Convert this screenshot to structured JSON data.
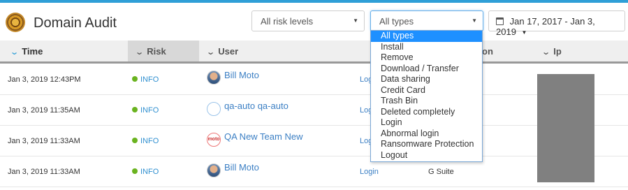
{
  "header": {
    "title": "Domain Audit",
    "risk_select": "All risk levels",
    "type_select": "All types",
    "date_range": "Jan 17, 2017 - Jan 3, 2019"
  },
  "table": {
    "columns": [
      "Time",
      "Risk",
      "User",
      "on",
      "Ip"
    ],
    "rows": [
      {
        "time": "Jan 3, 2019 12:43PM",
        "risk": "INFO",
        "user": "Bill Moto",
        "event": "Login",
        "source": ""
      },
      {
        "time": "Jan 3, 2019 11:35AM",
        "risk": "INFO",
        "user": "qa-auto qa-auto",
        "event": "Login",
        "source": ""
      },
      {
        "time": "Jan 3, 2019 11:33AM",
        "risk": "INFO",
        "user": "QA New Team New",
        "event": "Login",
        "source": ""
      },
      {
        "time": "Jan 3, 2019 11:33AM",
        "risk": "INFO",
        "user": "Bill Moto",
        "event": "Login",
        "source": "G Suite"
      }
    ]
  },
  "type_dropdown": {
    "options": [
      "All types",
      "Install",
      "Remove",
      "Download / Transfer",
      "Data sharing",
      "Credit Card",
      "Trash Bin",
      "Deleted completely",
      "Login",
      "Abnormal login",
      "Ransomware Protection",
      "Logout"
    ],
    "selected": "All types"
  },
  "avatar_text": "moto",
  "colors": {
    "accent": "#2f9fd7",
    "link": "#3b7fc4",
    "info_dot": "#6ab31f",
    "selected_option": "#1e90ff"
  }
}
